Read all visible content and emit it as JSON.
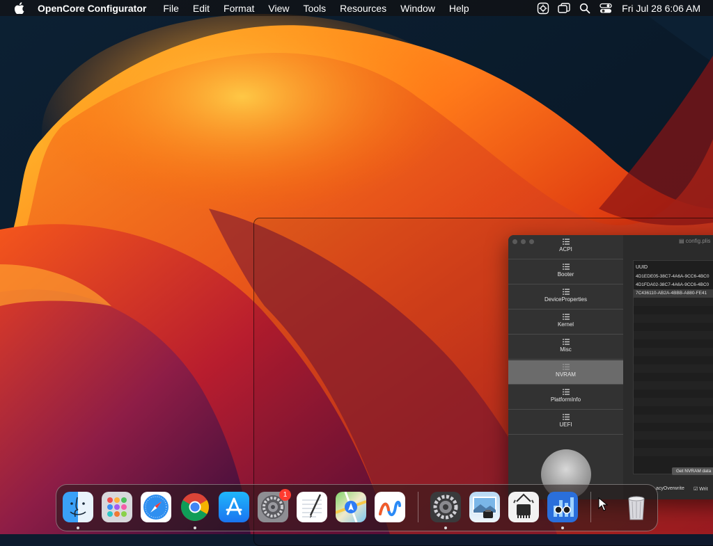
{
  "menubar": {
    "app_name": "OpenCore Configurator",
    "menus": [
      "File",
      "Edit",
      "Format",
      "View",
      "Tools",
      "Resources",
      "Window",
      "Help"
    ],
    "clock": "Fri Jul 28  6:06 AM"
  },
  "opencore": {
    "title": "config.plis",
    "sidebar": [
      {
        "label": "ACPI"
      },
      {
        "label": "Booter"
      },
      {
        "label": "DeviceProperties"
      },
      {
        "label": "Kernel"
      },
      {
        "label": "Misc"
      },
      {
        "label": "NVRAM",
        "selected": true
      },
      {
        "label": "PlatformInfo"
      },
      {
        "label": "UEFI"
      }
    ],
    "table_header": "UUID",
    "rows": [
      "4D1EDE05-38C7-4A6A-9CC6-4BC0",
      "4D1FDA02-38C7-4A6A-9CC6-4BC0",
      "7C436110-AB2A-4BBB-A880-FE41"
    ],
    "get_nvram_button": "Get NVRAM data",
    "legacy_overwrite": "acyOverwrite",
    "write_label": "Writ"
  },
  "dock": {
    "apps": [
      {
        "name": "finder-icon"
      },
      {
        "name": "launchpad-icon"
      },
      {
        "name": "safari-icon"
      },
      {
        "name": "chrome-icon"
      },
      {
        "name": "app-store-icon"
      },
      {
        "name": "system-settings-icon",
        "badge": "1"
      },
      {
        "name": "textedit-icon"
      },
      {
        "name": "maps-icon"
      },
      {
        "name": "freeform-icon"
      },
      {
        "name": "settings-gear-icon"
      },
      {
        "name": "preview-icon"
      },
      {
        "name": "system-information-icon"
      },
      {
        "name": "geekbench-icon"
      },
      {
        "name": "trash-icon"
      }
    ]
  },
  "colors": {
    "sidebar_selected": "#6b6b6b",
    "badge": "#ff3b30"
  }
}
